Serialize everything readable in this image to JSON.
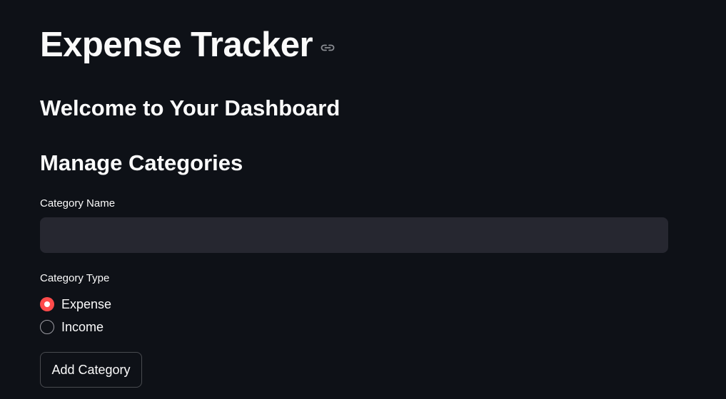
{
  "page": {
    "title": "Expense Tracker",
    "title_link_icon": "link-icon"
  },
  "dashboard": {
    "welcome_header": "Welcome to Your Dashboard"
  },
  "categories": {
    "header": "Manage Categories",
    "name_field": {
      "label": "Category Name",
      "value": "",
      "placeholder": ""
    },
    "type_field": {
      "label": "Category Type",
      "options": [
        {
          "label": "Expense",
          "selected": true
        },
        {
          "label": "Income",
          "selected": false
        }
      ]
    },
    "add_button_label": "Add Category"
  },
  "colors": {
    "background": "#0e1117",
    "input_background": "#262730",
    "accent": "#ff4b4b",
    "text": "#fafafa"
  }
}
